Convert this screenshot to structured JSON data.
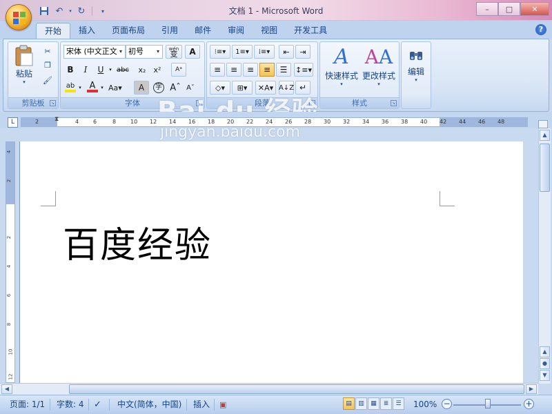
{
  "window": {
    "title": "文档 1 - Microsoft Word",
    "controls": {
      "minimize": "–",
      "maximize": "□",
      "close": "✕"
    }
  },
  "quick_access": {
    "icons": [
      "save-icon",
      "undo-icon",
      "redo-icon",
      "customize-icon"
    ]
  },
  "ribbon_tabs": [
    {
      "label": "开始",
      "active": true
    },
    {
      "label": "插入"
    },
    {
      "label": "页面布局"
    },
    {
      "label": "引用"
    },
    {
      "label": "邮件"
    },
    {
      "label": "审阅"
    },
    {
      "label": "视图"
    },
    {
      "label": "开发工具"
    }
  ],
  "groups": {
    "clipboard": {
      "label": "剪贴板",
      "paste": "粘贴"
    },
    "font": {
      "label": "字体",
      "font_name": "宋体 (中文正文",
      "font_size": "初号",
      "phonetic": "wén",
      "phonetic_char": "变"
    },
    "paragraph": {
      "label": "段落"
    },
    "styles": {
      "label": "样式",
      "quick_styles": "快速样式",
      "change_styles": "更改样式"
    },
    "editing": {
      "label": "编辑"
    }
  },
  "ruler": {
    "ticks": [
      "2",
      "2",
      "4",
      "6",
      "8",
      "10",
      "12",
      "14",
      "16",
      "18",
      "20",
      "22",
      "24",
      "26",
      "28",
      "30",
      "32",
      "34",
      "36",
      "38",
      "40",
      "42",
      "44",
      "46",
      "48"
    ],
    "vticks": [
      "4",
      "2",
      "2",
      "4",
      "6",
      "8",
      "10",
      "12"
    ]
  },
  "document": {
    "text": "百度经验"
  },
  "status": {
    "page": "页面: 1/1",
    "words": "字数: 4",
    "language": "中文(简体，中国)",
    "mode": "插入",
    "zoom": "100%"
  },
  "watermark": {
    "line1": "Bai du 经验",
    "line2": "jingyan.baidu.com"
  },
  "colors": {
    "accent": "#15428b",
    "ribbon": "#dbe7f6",
    "font_color_bar": "#e0302a",
    "highlight_bar": "#f7e400"
  }
}
